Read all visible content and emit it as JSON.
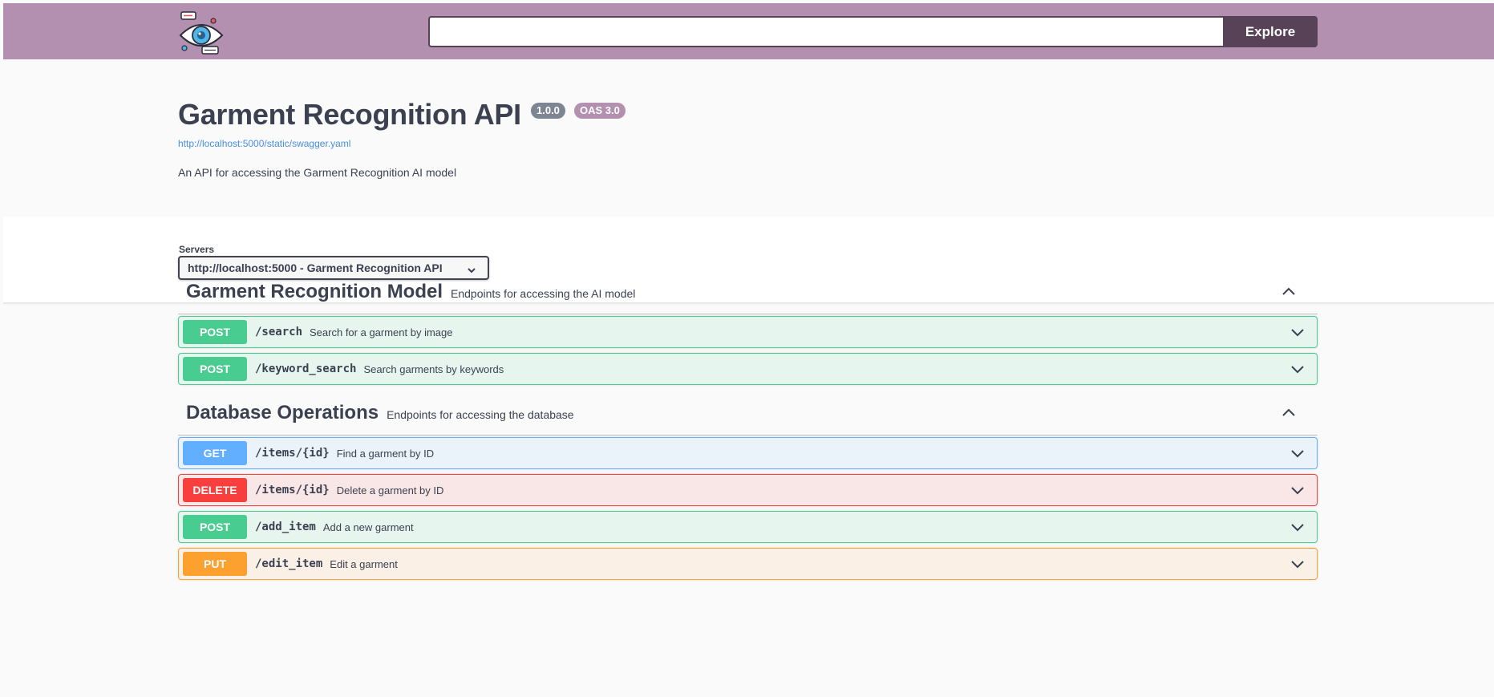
{
  "topbar": {
    "search_value": "",
    "explore_label": "Explore",
    "logo_icon": "eye-chat-icon"
  },
  "info": {
    "title": "Garment Recognition API",
    "version": "1.0.0",
    "oas": "OAS 3.0",
    "spec_url": "http://localhost:5000/static/swagger.yaml",
    "description": "An API for accessing the Garment Recognition AI model"
  },
  "servers": {
    "label": "Servers",
    "selected": "http://localhost:5000 - Garment Recognition API"
  },
  "tags": [
    {
      "name": "Garment Recognition Model",
      "description": "Endpoints for accessing the AI model",
      "operations": [
        {
          "method": "POST",
          "path": "/search",
          "summary": "Search for a garment by image"
        },
        {
          "method": "POST",
          "path": "/keyword_search",
          "summary": "Search garments by keywords"
        }
      ]
    },
    {
      "name": "Database Operations",
      "description": "Endpoints for accessing the database",
      "operations": [
        {
          "method": "GET",
          "path": "/items/{id}",
          "summary": "Find a garment by ID"
        },
        {
          "method": "DELETE",
          "path": "/items/{id}",
          "summary": "Delete a garment by ID"
        },
        {
          "method": "POST",
          "path": "/add_item",
          "summary": "Add a new garment"
        },
        {
          "method": "PUT",
          "path": "/edit_item",
          "summary": "Edit a garment"
        }
      ]
    }
  ],
  "colors": {
    "topbar": "#b38fb0",
    "explore": "#574258",
    "post": "#49cc90",
    "get": "#61affe",
    "delete": "#f93e3e",
    "put": "#fca130"
  }
}
